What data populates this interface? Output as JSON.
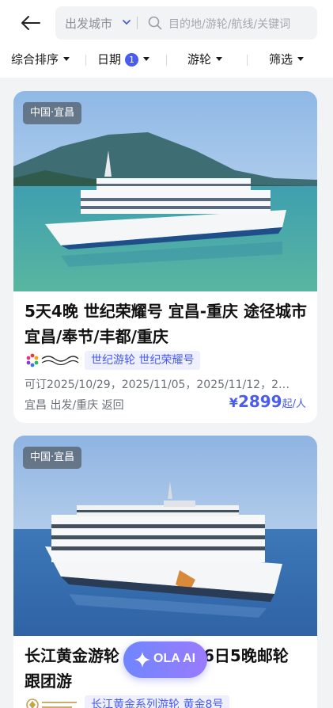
{
  "header": {
    "city_placeholder": "出发城市",
    "search_placeholder": "目的地/游轮/航线/关键词"
  },
  "filters": {
    "sort": "综合排序",
    "date": "日期",
    "date_badge": "1",
    "ship": "游轮",
    "filter": "筛选"
  },
  "cards": [
    {
      "location": "中国·宜昌",
      "title": "5天4晚 世纪荣耀号 宜昌-重庆 途径城市 宜昌/奉节/丰都/重庆",
      "brand": "世纪游轮 世纪荣耀号",
      "dates": "可订2025/10/29，2025/11/05，2025/11/12，2…",
      "route": "宜昌 出发/重庆 返回",
      "price_currency": "¥",
      "price": "2899",
      "price_suffix": "起/人"
    },
    {
      "location": "中国·宜昌",
      "title": "长江黄金游轮",
      "title_tail": "6日5晚邮轮",
      "title_line2": "跟团游",
      "brand": "长江黄金系列游轮 黄金8号"
    }
  ],
  "assistant": {
    "label": "OLA AI"
  },
  "colors": {
    "accent": "#4a5cf0",
    "brand_tag_bg": "#eef0ff"
  }
}
